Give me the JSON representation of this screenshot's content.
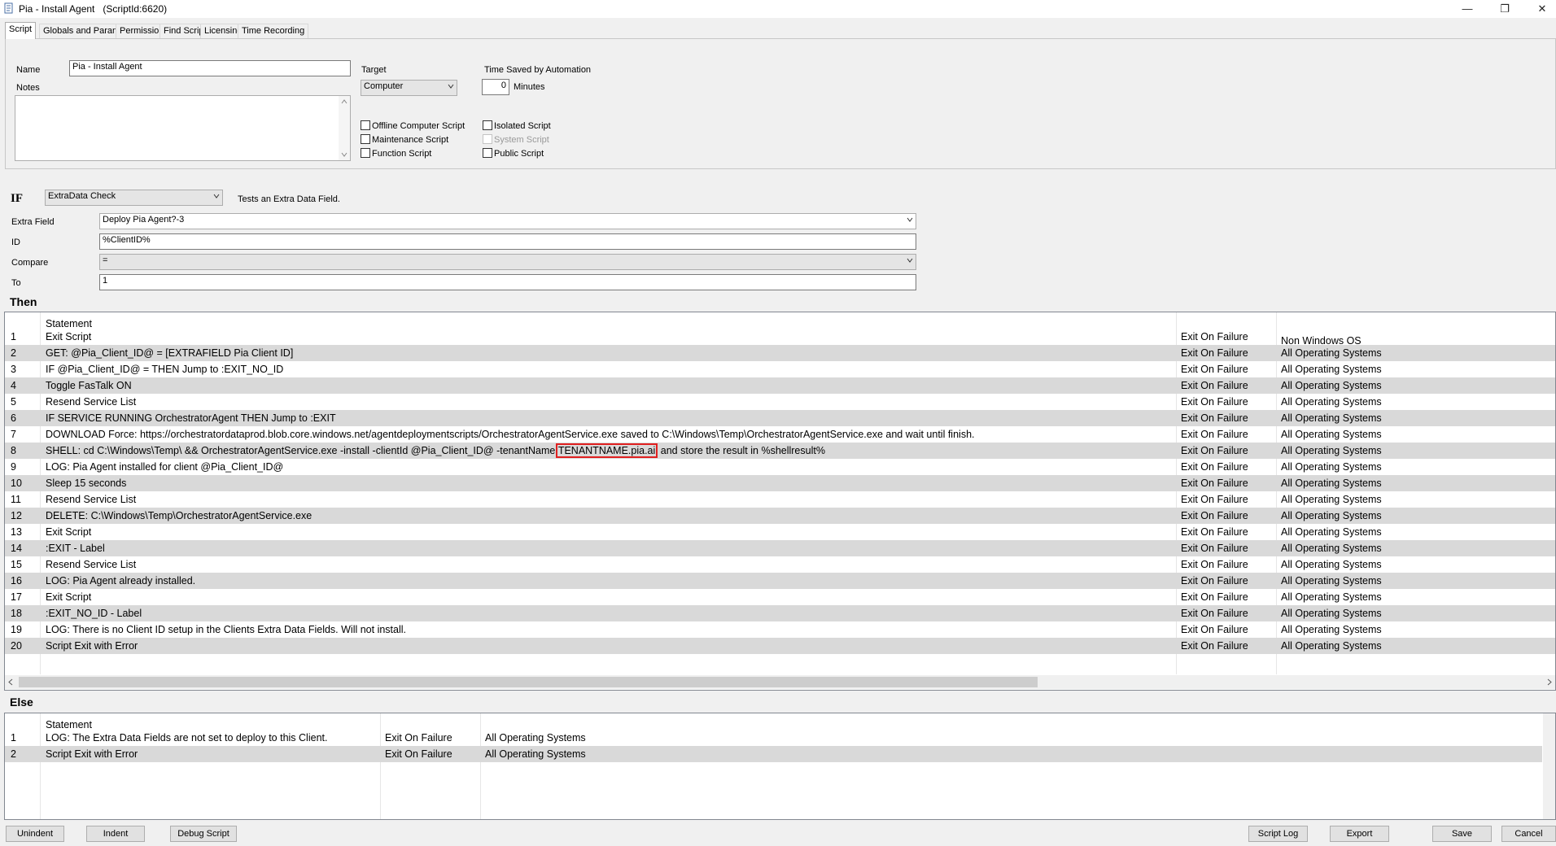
{
  "window": {
    "title": "Pia - Install Agent",
    "script_id": "(ScriptId:6620)",
    "minimize": "—",
    "restore": "❐",
    "close": "✕"
  },
  "tabs": [
    "Script",
    "Globals and Parameters",
    "Permissions",
    "Find Script",
    "Licensing",
    "Time Recording"
  ],
  "script_tab": {
    "name_label": "Name",
    "name_value": "Pia - Install Agent",
    "notes_label": "Notes",
    "notes_value": "",
    "target_label": "Target",
    "target_value": "Computer",
    "time_saved_label": "Time Saved by Automation",
    "time_saved_value": "0",
    "minutes_label": "Minutes",
    "offline_computer_script": "Offline Computer Script",
    "maintenance_script": "Maintenance Script",
    "function_script": "Function Script",
    "isolated_script": "Isolated Script",
    "system_script": "System Script",
    "public_script": "Public Script"
  },
  "if_section": {
    "if_label": "IF",
    "condition_type": "ExtraData Check",
    "condition_desc": "Tests an Extra Data Field.",
    "extra_field_label": "Extra Field",
    "extra_field_value": "Deploy Pia Agent?-3",
    "id_label": "ID",
    "id_value": "%ClientID%",
    "compare_label": "Compare",
    "compare_value": "=",
    "to_label": "To",
    "to_value": "1"
  },
  "then_section": {
    "label": "Then",
    "header_statement": "Statement",
    "header_col3": "Non Windows OS",
    "rows": [
      {
        "n": "1",
        "statement": "Exit Script",
        "failure": "Exit On Failure",
        "os": ""
      },
      {
        "n": "2",
        "statement": "GET:  @Pia_Client_ID@  =  [EXTRAFIELD Pia Client ID]",
        "failure": "Exit On Failure",
        "os": "All Operating Systems"
      },
      {
        "n": "3",
        "statement": "IF  @Pia_Client_ID@  =   THEN  Jump to :EXIT_NO_ID",
        "failure": "Exit On Failure",
        "os": "All Operating Systems"
      },
      {
        "n": "4",
        "statement": "Toggle FasTalk ON",
        "failure": "Exit On Failure",
        "os": "All Operating Systems"
      },
      {
        "n": "5",
        "statement": "Resend Service List",
        "failure": "Exit On Failure",
        "os": "All Operating Systems"
      },
      {
        "n": "6",
        "statement": "IF SERVICE RUNNING OrchestratorAgent  THEN  Jump to :EXIT",
        "failure": "Exit On Failure",
        "os": "All Operating Systems"
      },
      {
        "n": "7",
        "statement": "DOWNLOAD Force:  https://orchestratordataprod.blob.core.windows.net/agentdeploymentscripts/OrchestratorAgentService.exe  saved to  C:\\Windows\\Temp\\OrchestratorAgentService.exe  and wait until finish.",
        "failure": "Exit On Failure",
        "os": "All Operating Systems"
      },
      {
        "n": "8",
        "statement_pre": "SHELL:  cd C:\\Windows\\Temp\\ && OrchestratorAgentService.exe -install -clientId @Pia_Client_ID@ -tenantName ",
        "statement_highlight": "TENANTNAME.pia.ai",
        "statement_post": " and store the result in %shellresult%",
        "failure": "Exit On Failure",
        "os": "All Operating Systems"
      },
      {
        "n": "9",
        "statement": "LOG:  Pia Agent installed for client @Pia_Client_ID@",
        "failure": "Exit On Failure",
        "os": "All Operating Systems"
      },
      {
        "n": "10",
        "statement": "Sleep 15 seconds",
        "failure": "Exit On Failure",
        "os": "All Operating Systems"
      },
      {
        "n": "11",
        "statement": "Resend Service List",
        "failure": "Exit On Failure",
        "os": "All Operating Systems"
      },
      {
        "n": "12",
        "statement": "DELETE:  C:\\Windows\\Temp\\OrchestratorAgentService.exe",
        "failure": "Exit On Failure",
        "os": "All Operating Systems"
      },
      {
        "n": "13",
        "statement": "Exit Script",
        "failure": "Exit On Failure",
        "os": "All Operating Systems"
      },
      {
        "n": "14",
        "statement": ":EXIT - Label",
        "failure": "Exit On Failure",
        "os": "All Operating Systems"
      },
      {
        "n": "15",
        "statement": "Resend Service List",
        "failure": "Exit On Failure",
        "os": "All Operating Systems"
      },
      {
        "n": "16",
        "statement": "LOG:  Pia Agent already installed.",
        "failure": "Exit On Failure",
        "os": "All Operating Systems"
      },
      {
        "n": "17",
        "statement": "Exit Script",
        "failure": "Exit On Failure",
        "os": "All Operating Systems"
      },
      {
        "n": "18",
        "statement": ":EXIT_NO_ID - Label",
        "failure": "Exit On Failure",
        "os": "All Operating Systems"
      },
      {
        "n": "19",
        "statement": "LOG:  There is no Client ID setup in the Clients Extra Data Fields. Will not install.",
        "failure": "Exit On Failure",
        "os": "All Operating Systems"
      },
      {
        "n": "20",
        "statement": "Script Exit with Error",
        "failure": "Exit On Failure",
        "os": "All Operating Systems"
      }
    ]
  },
  "else_section": {
    "label": "Else",
    "header_statement": "Statement",
    "rows": [
      {
        "n": "1",
        "statement": "LOG:  The Extra Data Fields are not set to deploy to this Client.",
        "failure": "Exit On Failure",
        "os": "All Operating Systems"
      },
      {
        "n": "2",
        "statement": "Script Exit with Error",
        "failure": "Exit On Failure",
        "os": "All Operating Systems"
      }
    ]
  },
  "buttons": {
    "unindent": "Unindent",
    "indent": "Indent",
    "debug": "Debug Script",
    "script_log": "Script Log",
    "export": "Export",
    "save": "Save",
    "cancel": "Cancel"
  },
  "colors": {
    "highlight_border": "#e02020",
    "alt_row": "#d9d9d9"
  }
}
